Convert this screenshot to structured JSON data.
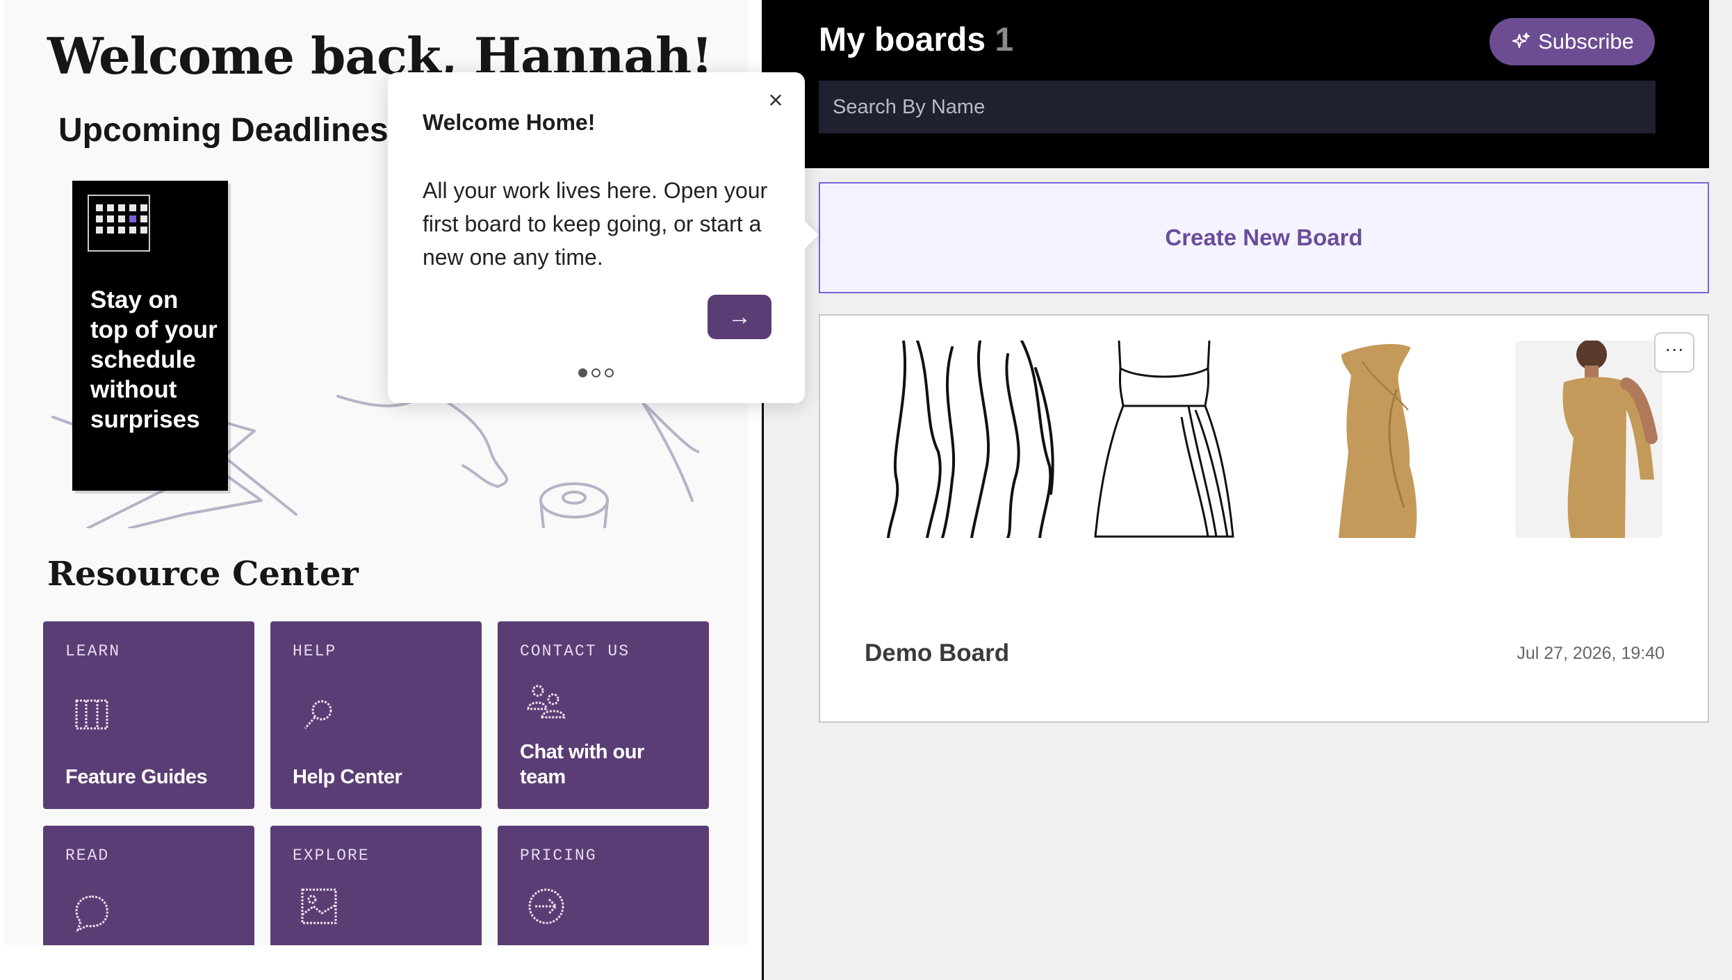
{
  "left": {
    "welcome": "Welcome back, Hannah!",
    "deadlines_title": "Upcoming Deadlines",
    "deadline_card": {
      "text": "Stay on top of your schedule without surprises",
      "icon": "calendar-icon"
    },
    "popover": {
      "title": "Welcome Home!",
      "body": "All your work lives here. Open your first board to keep going, or start a new one any time.",
      "close_icon": "×",
      "next_icon": "→",
      "step": 1,
      "steps": 3
    },
    "resource_title": "Resource Center",
    "tiles": [
      {
        "kicker": "LEARN",
        "label": "Feature Guides",
        "icon": "book-icon"
      },
      {
        "kicker": "HELP",
        "label": "Help Center",
        "icon": "magnifier-icon"
      },
      {
        "kicker": "CONTACT US",
        "label": "Chat with our team",
        "icon": "people-icon"
      },
      {
        "kicker": "READ",
        "label": "",
        "icon": "speech-bubble-icon"
      },
      {
        "kicker": "EXPLORE",
        "label": "",
        "icon": "image-icon"
      },
      {
        "kicker": "PRICING",
        "label": "",
        "icon": "arrow-circle-icon"
      }
    ]
  },
  "right": {
    "title": "My boards",
    "count": "1",
    "subscribe_label": "Subscribe",
    "search_placeholder": "Search By Name",
    "create_label": "Create New Board",
    "board": {
      "name": "Demo Board",
      "date": "Jul 27, 2026, 19:40",
      "more_label": "···"
    }
  },
  "colors": {
    "brand_purple": "#5b3d75",
    "subscribe_purple": "#6d4d92",
    "create_border": "#7466d9",
    "dress_tan": "#c49a5a"
  }
}
